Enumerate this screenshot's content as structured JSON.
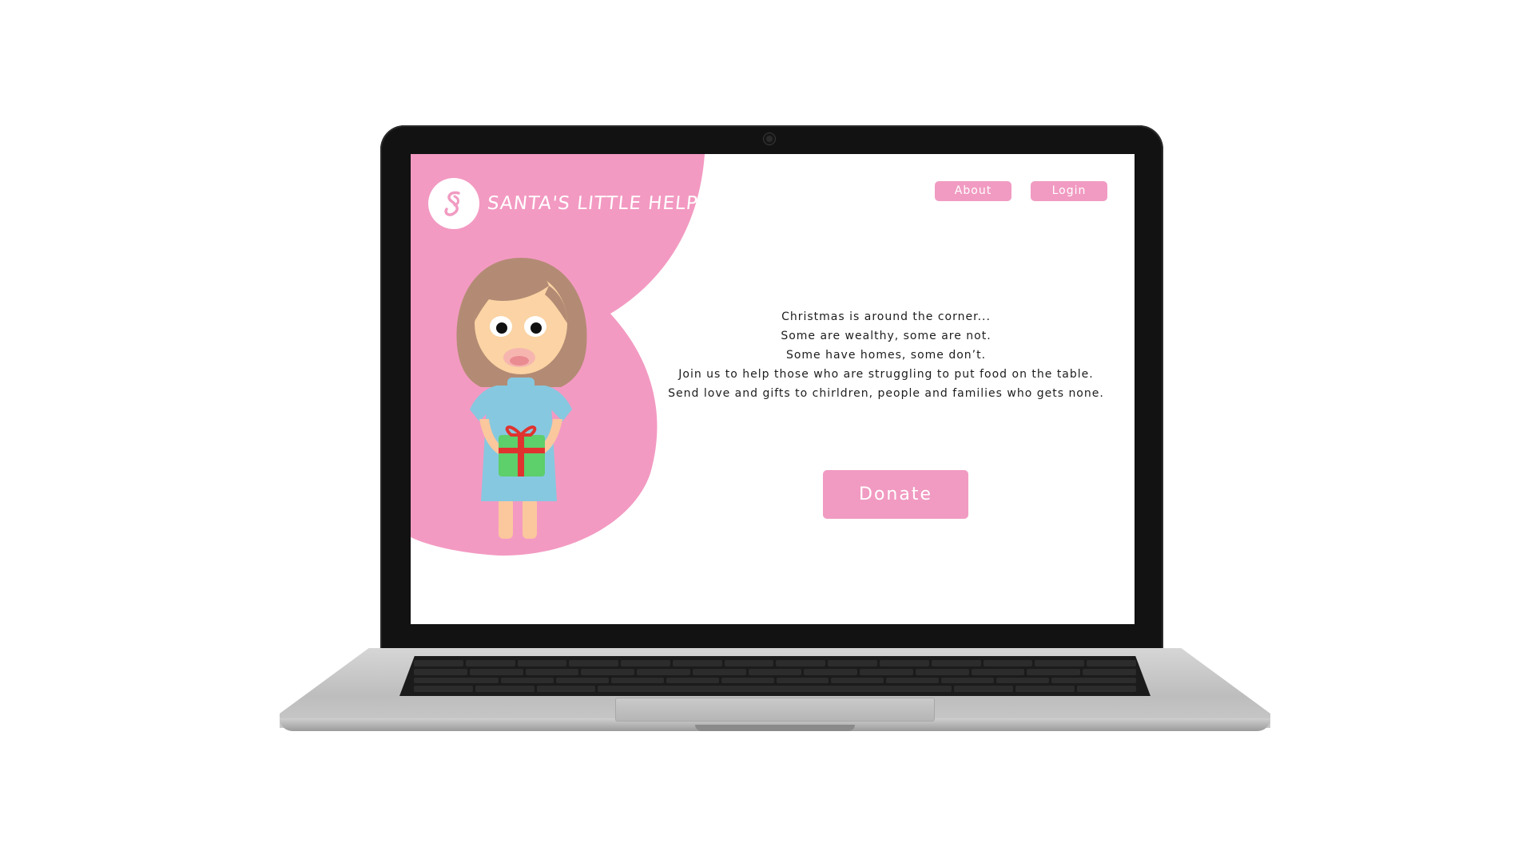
{
  "brand": {
    "name": "SANTA'S LITTLE HELPER"
  },
  "nav": {
    "about_label": "About",
    "login_label": "Login"
  },
  "message": {
    "lines": [
      "Christmas is around the corner...",
      "Some are wealthy, some are not.",
      "Some have homes, some don’t.",
      "Join us to help those who are struggling to put food on the table.",
      "Send love and gifts to chirldren, people and families who gets none."
    ]
  },
  "cta": {
    "donate_label": "Donate"
  },
  "colors": {
    "accent_pink": "#f19bc2",
    "blob_pink": "#f39ac2",
    "laptop_bezel": "#121212"
  },
  "icons": {
    "logo": "santa-helper-logo-icon",
    "illustration": "girl-with-gift-illustration"
  }
}
